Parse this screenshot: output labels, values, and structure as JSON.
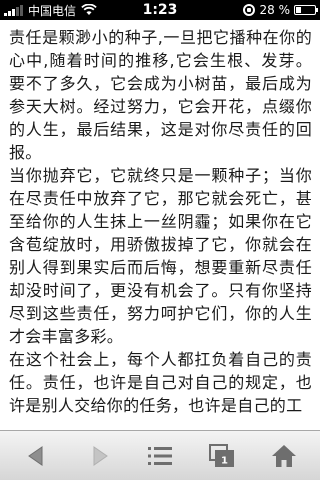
{
  "status_bar": {
    "carrier": "中国电信",
    "time": "1:23",
    "battery_percent": "28 %",
    "battery_level": 0.28
  },
  "article": {
    "paragraphs": [
      "责任是颗渺小的种子,一旦把它播种在你的心中,随着时间的推移,它会生根、发芽。要不了多久，它会成为小树苗，最后成为参天大树。经过努力，它会开花，点缀你的人生，最后结果，这是对你尽责任的回报。",
      "当你抛弃它，它就终只是一颗种子；当你在尽责任中放弃了它，那它就会死亡，甚至给你的人生抹上一丝阴霾；如果你在它含苞绽放时，用骄傲拔掉了它，你就会在别人得到果实后而后悔，想要重新尽责任却没时间了，更没有机会了。只有你坚持尽到这些责任，努力呵护它们，你的人生才会丰富多彩。",
      "在这个社会上，每个人都扛负着自己的责任。责任，也许是自己对自己的规定，也许是别人交给你的任务，也许是自己的工"
    ]
  },
  "toolbar": {
    "icons": [
      "back-arrow-icon",
      "forward-arrow-icon",
      "menu-list-icon",
      "pages-icon",
      "home-icon"
    ],
    "pages_count": "1"
  }
}
